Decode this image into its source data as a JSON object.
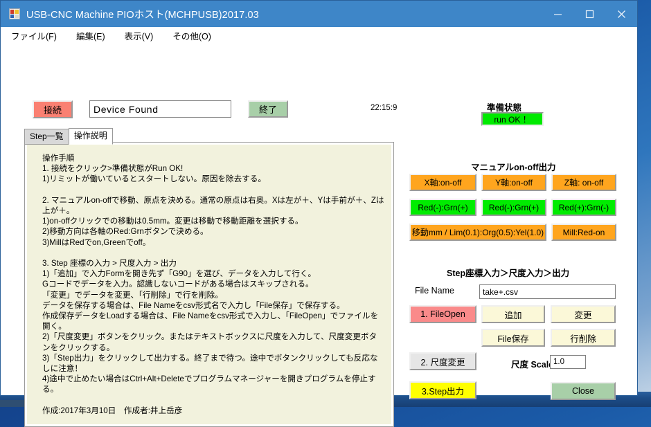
{
  "window": {
    "title": "USB-CNC Machine PIOホスト(MCHPUSB)2017.03",
    "icon": "app-icon",
    "controls": {
      "minimize": "minimize-icon",
      "maximize": "maximize-icon",
      "close": "close-icon"
    }
  },
  "menubar": {
    "items": [
      {
        "label": "ファイル(F)"
      },
      {
        "label": "編集(E)"
      },
      {
        "label": "表示(V)"
      },
      {
        "label": "その他(O)"
      }
    ]
  },
  "toolbar": {
    "connect_label": "接続",
    "status_value": "Device Found",
    "quit_label": "終了",
    "clock": "22:15:9"
  },
  "tabs": [
    {
      "label": "Step一覧",
      "active": false
    },
    {
      "label": "操作説明",
      "active": true
    }
  ],
  "instructions": {
    "text": "操作手順\n1. 接続をクリック>準備状態がRun OK!\n1)リミットが働いているとスタートしない。原因を除去する。\n\n2. マニュアルon-offで移動、原点を決める。通常の原点は右奥。Xは左が＋、Yは手前が＋、Zは上が＋。\n1)on-offクリックでの移動は0.5mm。変更は移動で移動距離を選択する。\n2)移動方向は各軸のRed:Grnボタンで決める。\n3)MillはRedでon,Greenでoff。\n\n3. Step 座標の入力 > 尺度入力 > 出力\n1)「追加」で入力Formを開き先ず「G90」を選び、データを入力して行く。\nGコードでデータを入力。認識しないコードがある場合はスキップされる。\n「変更」でデータを変更、「行削除」で行を削除。\nデータを保存する場合は、File Nameをcsv形式名で入力し「File保存」で保存する。\n作成保存データをLoadする場合は、File Nameをcsv形式で入力し、「FileOpen」でファイルを開く。\n2)「尺度変更」ボタンをクリック。またはテキストボックスに尺度を入力して、尺度変更ボタンをクリックする。\n3)「Step出力」をクリックして出力する。終了まで待つ。途中でボタンクリックしても反応なしに注意！\n4)途中で止めたい場合はCtrl+Alt+Deleteでプログラムマネージャーを開きプログラムを停止する。\n\n作成:2017年3月10日　作成者:井上岳彦"
  },
  "ready": {
    "title": "準備状態",
    "status": "run OK ！",
    "status_color": "#00ea00"
  },
  "manual": {
    "title": "マニュアルon-off出力",
    "buttons": [
      {
        "label": "X軸:on-off",
        "color": "#ffa51e"
      },
      {
        "label": "Y軸:on-off",
        "color": "#ffa51e"
      },
      {
        "label": "Z軸: on-off",
        "color": "#ffa51e"
      },
      {
        "label": "Red(-):Grn(+)",
        "color": "#00ec00"
      },
      {
        "label": "Red(-):Grn(+)",
        "color": "#00ec00"
      },
      {
        "label": "Red(+):Grn(-)",
        "color": "#00ec00"
      },
      {
        "label": "移動mm / Lim(0.1):Org(0.5):Yel(1.0)",
        "color": "#ffa51e"
      },
      {
        "label": "Mill:Red-on",
        "color": "#ffa51e"
      }
    ]
  },
  "step": {
    "title": "Step座標入力＞尺度入力＞出力",
    "filename_label": "File Name",
    "filename_value": "take+.csv",
    "fileopen_label": "1. FileOpen",
    "add_label": "追加",
    "change_label": "変更",
    "save_label": "File保存",
    "delete_row_label": "行削除",
    "scale_button_label": "2. 尺度変更",
    "scale_label": "尺度  Scale=",
    "scale_value": "1.0",
    "step_output_label": "3.Step出力",
    "close_label": "Close"
  }
}
